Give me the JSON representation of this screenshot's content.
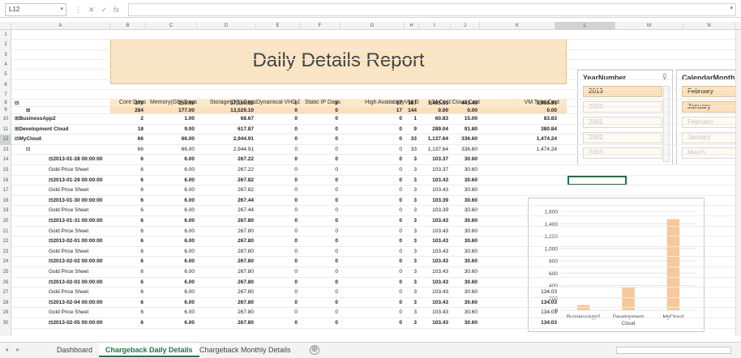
{
  "formula_bar": {
    "cell_ref": "L12",
    "fx": "fx",
    "value": ""
  },
  "columns": [
    "A",
    "B",
    "C",
    "D",
    "E",
    "F",
    "G",
    "H",
    "I",
    "J",
    "K",
    "L",
    "M",
    "N"
  ],
  "selected_column": "L",
  "rows": [
    "1",
    "2",
    "3",
    "4",
    "5",
    "6",
    "7",
    "8",
    "9",
    "10",
    "11",
    "12",
    "13",
    "14",
    "15",
    "16",
    "17",
    "18",
    "19",
    "20",
    "21",
    "22",
    "23",
    "24",
    "25",
    "26",
    "27",
    "28",
    "29",
    "30"
  ],
  "selected_row": "12",
  "report_title": "Daily Details Report",
  "table": {
    "headers": [
      "Core Days",
      "Memory(GB) Days",
      "Storage(GB) Days",
      "Dynamical VHD Da",
      "Static IP Days",
      "High Availability",
      "VM Days",
      "VM Cost",
      "Cloud Cost",
      "VM Total Cost"
    ],
    "rows": [
      {
        "label": "⊟",
        "level": 0,
        "bold": true,
        "values": [
          "370",
          "253.00",
          "17,160.55",
          "0",
          "0",
          "17",
          "187",
          "1,495.51",
          "443.40",
          "1,938.91"
        ]
      },
      {
        "label": "⊞",
        "level": 1,
        "bold": true,
        "values": [
          "284",
          "177.00",
          "13,529.10",
          "0",
          "0",
          "17",
          "144",
          "0.00",
          "0.00",
          "0.00"
        ]
      },
      {
        "label": "⊞BusinessApp2",
        "level": 0,
        "bold": true,
        "values": [
          "2",
          "1.00",
          "68.67",
          "0",
          "0",
          "0",
          "1",
          "60.83",
          "15.00",
          "83.83"
        ]
      },
      {
        "label": "⊞Development Cloud",
        "level": 0,
        "bold": true,
        "values": [
          "18",
          "9.00",
          "617.87",
          "0",
          "0",
          "0",
          "9",
          "289.04",
          "91.80",
          "380.84"
        ]
      },
      {
        "label": "⊟MyCloud",
        "level": 0,
        "bold": true,
        "values": [
          "66",
          "66.00",
          "2,944.91",
          "0",
          "0",
          "0",
          "33",
          "1,137.64",
          "336.60",
          "1,474.24"
        ]
      },
      {
        "label": "⊟",
        "level": 1,
        "bold": false,
        "values": [
          "66",
          "66.00",
          "2,944.91",
          "0",
          "0",
          "0",
          "33",
          "1,137.64",
          "336.60",
          "1,474.24"
        ]
      },
      {
        "label": "⊟2013-01-28 00:00:00",
        "level": 2,
        "bold": true,
        "values": [
          "6",
          "6.00",
          "267.22",
          "0",
          "0",
          "0",
          "3",
          "103.37",
          "30.60",
          ""
        ]
      },
      {
        "label": "Gold Price Sheet",
        "level": 2,
        "bold": false,
        "values": [
          "6",
          "6.00",
          "267.22",
          "0",
          "0",
          "0",
          "3",
          "103.37",
          "30.60",
          ""
        ]
      },
      {
        "label": "⊟2013-01-29 00:00:00",
        "level": 2,
        "bold": true,
        "values": [
          "6",
          "6.00",
          "267.82",
          "0",
          "0",
          "0",
          "3",
          "103.43",
          "30.60",
          ""
        ]
      },
      {
        "label": "Gold Price Sheet",
        "level": 2,
        "bold": false,
        "values": [
          "6",
          "6.00",
          "267.82",
          "0",
          "0",
          "0",
          "3",
          "103.43",
          "30.60",
          ""
        ]
      },
      {
        "label": "⊟2013-01-30 00:00:00",
        "level": 2,
        "bold": true,
        "values": [
          "6",
          "6.00",
          "267.44",
          "0",
          "0",
          "0",
          "3",
          "103.39",
          "30.60",
          ""
        ]
      },
      {
        "label": "Gold Price Sheet",
        "level": 2,
        "bold": false,
        "values": [
          "6",
          "6.00",
          "267.44",
          "0",
          "0",
          "0",
          "3",
          "103.39",
          "30.60",
          ""
        ]
      },
      {
        "label": "⊟2013-01-31 00:00:00",
        "level": 2,
        "bold": true,
        "values": [
          "6",
          "6.00",
          "267.80",
          "0",
          "0",
          "0",
          "3",
          "103.43",
          "30.60",
          ""
        ]
      },
      {
        "label": "Gold Price Sheet",
        "level": 2,
        "bold": false,
        "values": [
          "6",
          "6.00",
          "267.80",
          "0",
          "0",
          "0",
          "3",
          "103.43",
          "30.60",
          ""
        ]
      },
      {
        "label": "⊟2013-02-01 00:00:00",
        "level": 2,
        "bold": true,
        "values": [
          "6",
          "6.00",
          "267.80",
          "0",
          "0",
          "0",
          "3",
          "103.43",
          "30.60",
          ""
        ]
      },
      {
        "label": "Gold Price Sheet",
        "level": 2,
        "bold": false,
        "values": [
          "6",
          "6.00",
          "267.80",
          "0",
          "0",
          "0",
          "3",
          "103.43",
          "30.60",
          ""
        ]
      },
      {
        "label": "⊟2013-02-02 00:00:00",
        "level": 2,
        "bold": true,
        "values": [
          "6",
          "6.00",
          "267.80",
          "0",
          "0",
          "0",
          "3",
          "103.43",
          "30.60",
          ""
        ]
      },
      {
        "label": "Gold Price Sheet",
        "level": 2,
        "bold": false,
        "values": [
          "6",
          "6.00",
          "267.80",
          "0",
          "0",
          "0",
          "3",
          "103.43",
          "30.60",
          ""
        ]
      },
      {
        "label": "⊟2013-02-03 00:00:00",
        "level": 2,
        "bold": true,
        "values": [
          "6",
          "6.00",
          "267.80",
          "0",
          "0",
          "0",
          "3",
          "103.43",
          "30.60",
          ""
        ]
      },
      {
        "label": "Gold Price Sheet",
        "level": 2,
        "bold": false,
        "values": [
          "6",
          "6.00",
          "267.80",
          "0",
          "0",
          "0",
          "3",
          "103.43",
          "30.60",
          "134.03"
        ]
      },
      {
        "label": "⊟2013-02-04 00:00:00",
        "level": 2,
        "bold": true,
        "values": [
          "6",
          "6.00",
          "267.80",
          "0",
          "0",
          "0",
          "3",
          "103.43",
          "30.60",
          "134.03"
        ]
      },
      {
        "label": "Gold Price Sheet",
        "level": 2,
        "bold": false,
        "values": [
          "6",
          "6.00",
          "267.80",
          "0",
          "0",
          "0",
          "3",
          "103.43",
          "30.60",
          "134.03"
        ]
      },
      {
        "label": "⊟2013-02-05 00:00:00",
        "level": 2,
        "bold": true,
        "values": [
          "6",
          "6.00",
          "267.80",
          "0",
          "0",
          "0",
          "3",
          "103.43",
          "30.60",
          "134.03"
        ]
      }
    ]
  },
  "slicers": {
    "year": {
      "title": "YearNumber",
      "items": [
        "2013",
        "2000",
        "2001",
        "2002",
        "2003"
      ],
      "selected": [
        "2013"
      ]
    },
    "month": {
      "title": "CalendarMonth",
      "items": [
        "February",
        "January",
        "February",
        "January",
        "March"
      ],
      "selected": [
        "February",
        "January"
      ]
    }
  },
  "chart_data": {
    "type": "bar",
    "categories": [
      "BusinessApp2",
      "Development Cloud",
      "MyCloud"
    ],
    "values": [
      83.83,
      380.84,
      1474.24
    ],
    "ylim": [
      0,
      1600
    ],
    "yticks": [
      0,
      200,
      400,
      600,
      800,
      1000,
      1200,
      1400,
      1600
    ],
    "ytick_labels": [
      "0",
      "200",
      "400",
      "600",
      "800",
      "1,000",
      "1,200",
      "1,400",
      "1,600"
    ],
    "grid": true,
    "bar_color": "#f6c89a"
  },
  "tabs": {
    "items": [
      "Dashboard",
      "Chargeback Daily Details",
      "Chargeback Monthly Details"
    ],
    "active": "Chargeback Daily Details",
    "add": "⊕"
  },
  "colors": {
    "accent": "#217346",
    "header_fill": "#fbe4c1",
    "total_fill": "#fbe0ba"
  }
}
